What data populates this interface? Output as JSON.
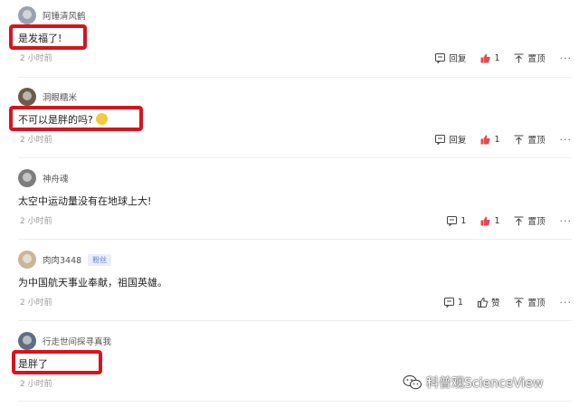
{
  "comments": [
    {
      "user": "阿锤清风鹤",
      "text": "是发福了!",
      "time": "2 小时前",
      "reply": "回复",
      "likes": "1",
      "pin": "置顶",
      "more": "···"
    },
    {
      "user": "洞眼糯米",
      "text": "不可以是胖的吗?",
      "time": "2 小时前",
      "reply": "回复",
      "likes": "1",
      "pin": "置顶",
      "more": "···"
    },
    {
      "user": "神舟魂",
      "text": "太空中运动量没有在地球上大!",
      "time": "2 小时前",
      "replies": "1",
      "likes": "1",
      "pin": "置顶",
      "more": "···"
    },
    {
      "user": "肉肉3448",
      "badge": "粉丝",
      "text": "为中国航天事业奉献，祖国英雄。",
      "time": "2 小时前",
      "replies": "1",
      "like_label": "赞",
      "pin": "置顶",
      "more": "···"
    },
    {
      "user": "行走世间探寻真我",
      "text": "是胖了",
      "time": "2 小时前"
    }
  ],
  "watermark": "科普观ScienceView",
  "colors": {
    "highlight": "#d7141e",
    "like_active": "#e5484d",
    "badge_bg": "#e8eefc"
  }
}
